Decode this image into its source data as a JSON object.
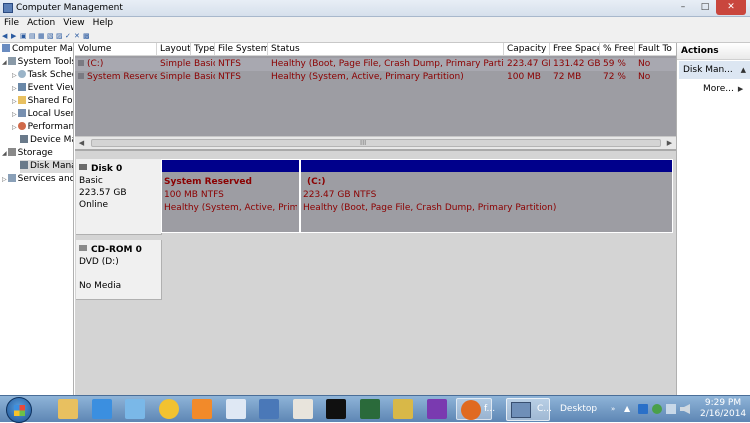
{
  "window": {
    "title": "Computer Management",
    "controls": [
      "–",
      "□",
      "✕"
    ]
  },
  "menu": [
    "File",
    "Action",
    "View",
    "Help"
  ],
  "tree": [
    {
      "label": "Computer Man",
      "indent": 0
    },
    {
      "label": "System Tools",
      "indent": 1
    },
    {
      "label": "Task Schedu",
      "indent": 2
    },
    {
      "label": "Event Viewe",
      "indent": 2
    },
    {
      "label": "Shared Fold",
      "indent": 2
    },
    {
      "label": "Local Users",
      "indent": 2
    },
    {
      "label": "Performanc",
      "indent": 2
    },
    {
      "label": "Device Man",
      "indent": 2
    },
    {
      "label": "Storage",
      "indent": 1
    },
    {
      "label": "Disk Manag",
      "indent": 2
    },
    {
      "label": "Services and A",
      "indent": 1
    }
  ],
  "volume_table": {
    "headers": [
      "Volume",
      "Layout",
      "Type",
      "File System",
      "Status",
      "Capacity",
      "Free Space",
      "% Free",
      "Fault To"
    ],
    "rows": [
      [
        "(C:)",
        "Simple",
        "Basic",
        "NTFS",
        "Healthy (Boot, Page File, Crash Dump, Primary Partition)",
        "223.47 GB",
        "131.42 GB",
        "59 %",
        "No"
      ],
      [
        "System Reserved",
        "Simple",
        "Basic",
        "NTFS",
        "Healthy (System, Active, Primary Partition)",
        "100 MB",
        "72 MB",
        "72 %",
        "No"
      ]
    ],
    "scroll_grip": "III"
  },
  "disks": [
    {
      "name": "Disk 0",
      "type": "Basic",
      "size": "223.57 GB",
      "state": "Online",
      "partitions": [
        {
          "name": "System Reserved",
          "size": "100 MB NTFS",
          "status": "Healthy (System, Active, Primary"
        },
        {
          "name": "(C:)",
          "size": "223.47 GB NTFS",
          "status": "Healthy (Boot, Page File, Crash Dump, Primary Partition)"
        }
      ]
    },
    {
      "name": "CD-ROM 0",
      "type": "DVD (D:)",
      "state": "No Media"
    }
  ],
  "actions": {
    "header": "Actions",
    "section": "Disk Man...",
    "more": "More..."
  },
  "taskbar": {
    "active_label": "C...",
    "desktop_label": "Desktop",
    "time": "9:29 PM",
    "date": "2/16/2014",
    "apps": [
      {
        "name": "explorer",
        "color": "#e8c060"
      },
      {
        "name": "internet-explorer",
        "color": "#3b8fe0"
      },
      {
        "name": "notes",
        "color": "#7ab8e8"
      },
      {
        "name": "j-app",
        "color": "#f2c230"
      },
      {
        "name": "media-player",
        "color": "#f28a2a"
      },
      {
        "name": "text-editor",
        "color": "#dfe8f4"
      },
      {
        "name": "remote-desktop",
        "color": "#4a78b8"
      },
      {
        "name": "disk-tool",
        "color": "#e8e4dc"
      },
      {
        "name": "terminal",
        "color": "#101010"
      },
      {
        "name": "task-tool",
        "color": "#2a6a3a"
      },
      {
        "name": "tools",
        "color": "#d8b848"
      },
      {
        "name": "cpu-z",
        "color": "#7a3ab0"
      },
      {
        "name": "firefox",
        "color": "#e06a20"
      }
    ],
    "focused_app_label": "f..."
  }
}
